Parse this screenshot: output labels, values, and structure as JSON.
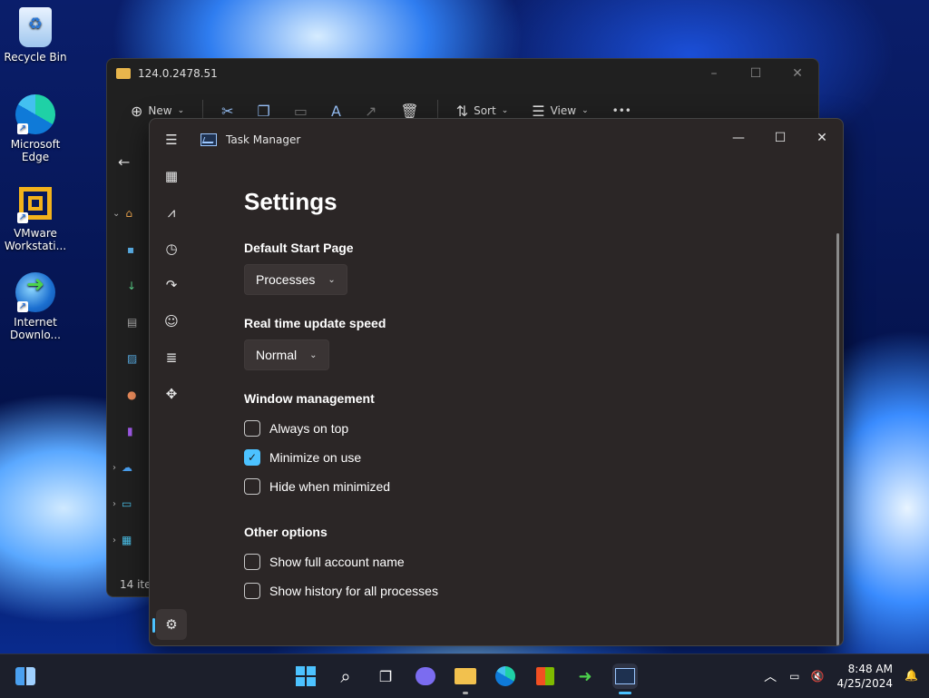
{
  "desktop": {
    "icons": [
      {
        "label": "Recycle Bin",
        "icon": "recycle-bin-icon"
      },
      {
        "label": "Microsoft Edge",
        "icon": "edge-icon"
      },
      {
        "label": "VMware Workstati...",
        "icon": "vmware-icon"
      },
      {
        "label": "Internet Downlo...",
        "icon": "idm-icon"
      }
    ]
  },
  "explorer": {
    "title": "124.0.2478.51",
    "toolbar": {
      "new_label": "New",
      "sort_label": "Sort",
      "view_label": "View",
      "more_label": "•••"
    },
    "status": "14 iter"
  },
  "taskmanager": {
    "title": "Task Manager",
    "heading": "Settings",
    "sections": {
      "start_page": {
        "label": "Default Start Page",
        "value": "Processes"
      },
      "update_speed": {
        "label": "Real time update speed",
        "value": "Normal"
      },
      "window_mgmt": {
        "label": "Window management",
        "options": [
          {
            "label": "Always on top",
            "checked": false
          },
          {
            "label": "Minimize on use",
            "checked": true
          },
          {
            "label": "Hide when minimized",
            "checked": false
          }
        ]
      },
      "other": {
        "label": "Other options",
        "options": [
          {
            "label": "Show full account name",
            "checked": false
          },
          {
            "label": "Show history for all processes",
            "checked": false
          }
        ]
      }
    },
    "accent_color": "#4cc2ff"
  },
  "taskbar": {
    "time": "8:48 AM",
    "date": "4/25/2024"
  }
}
